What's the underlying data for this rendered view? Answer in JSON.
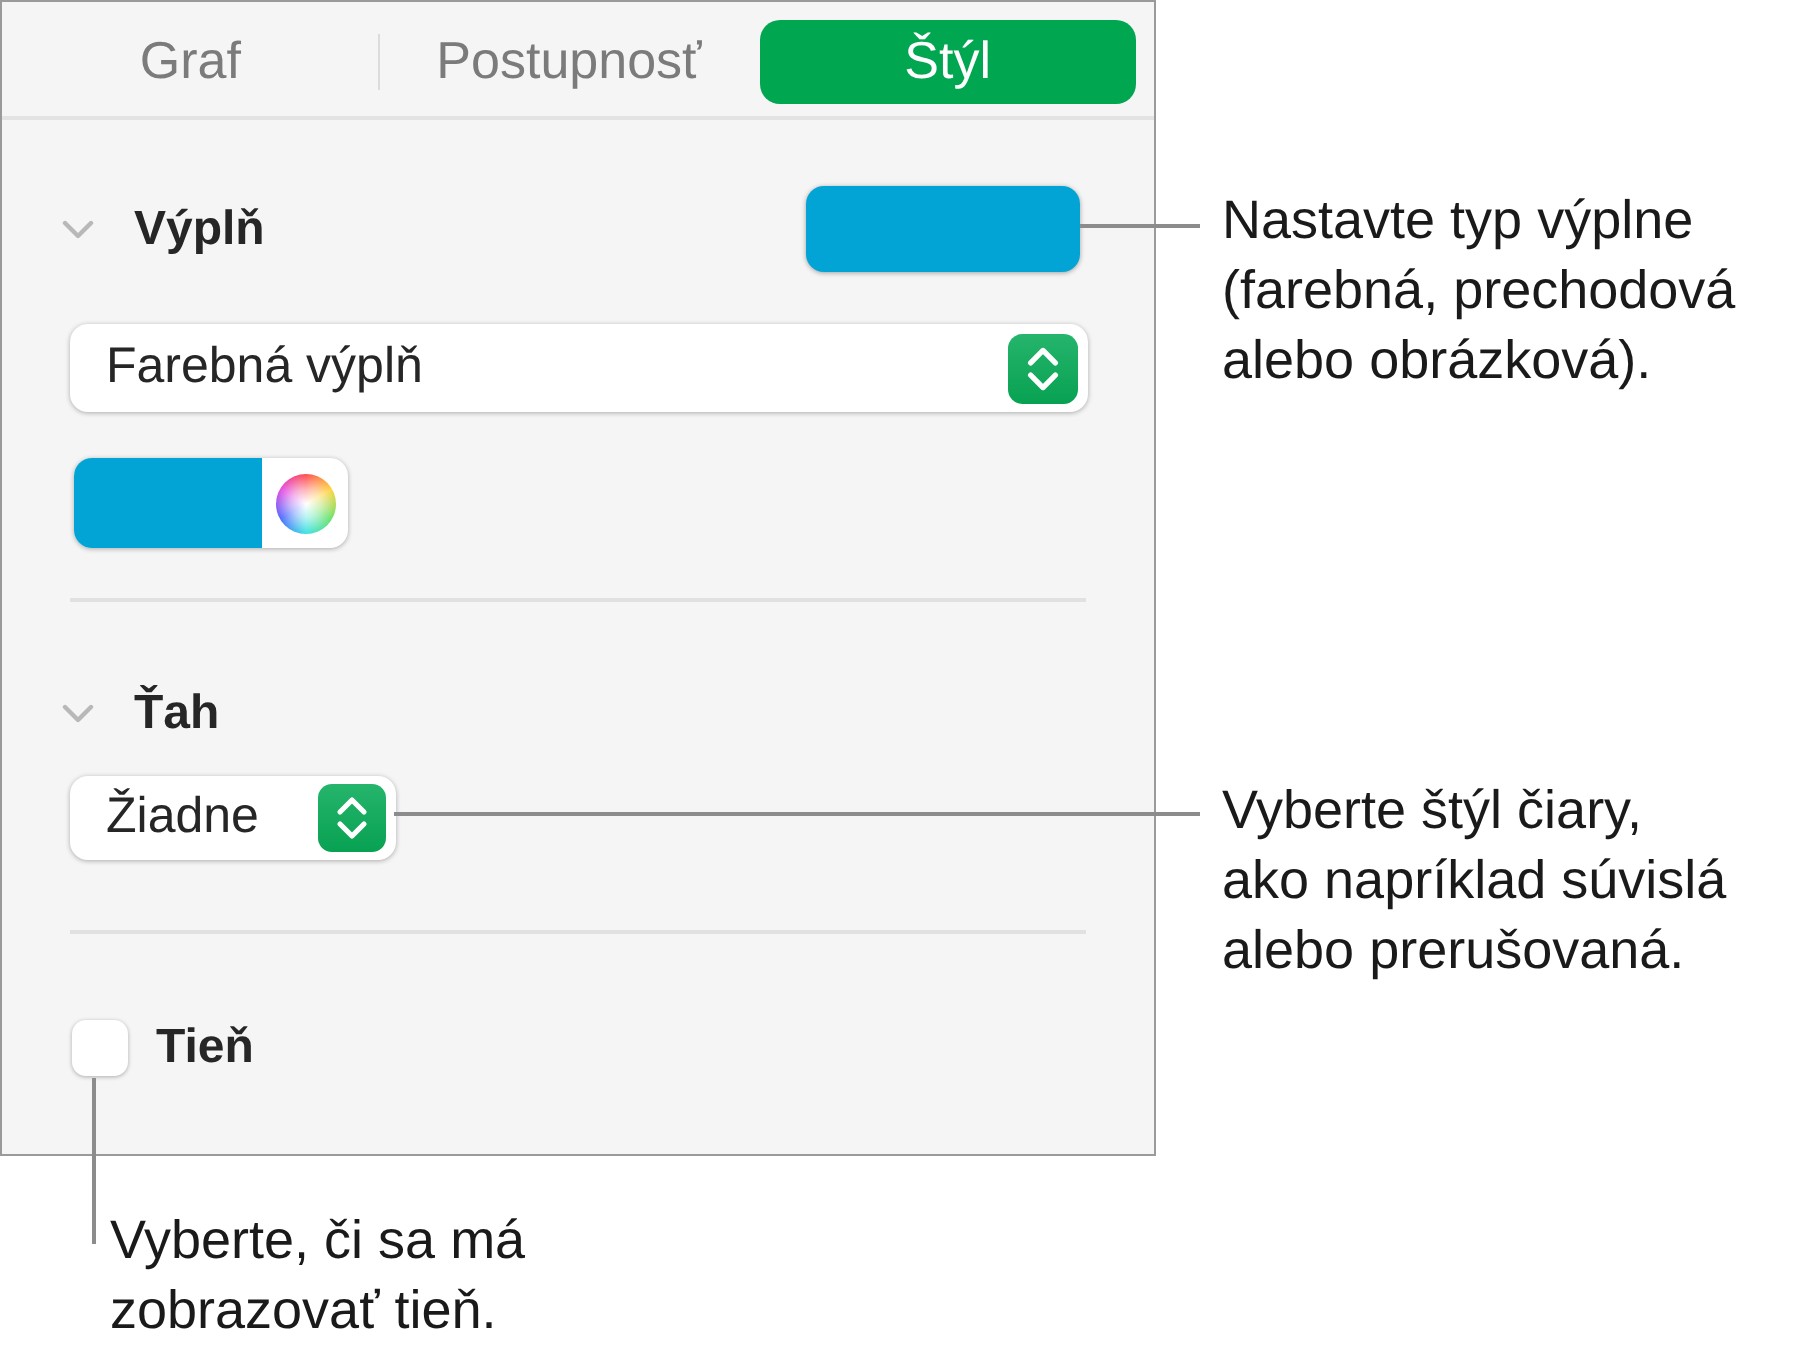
{
  "tabs": [
    {
      "label": "Graf",
      "selected": false
    },
    {
      "label": "Postupnosť",
      "selected": false
    },
    {
      "label": "Štýl",
      "selected": true
    }
  ],
  "sections": [
    {
      "kind": "fill",
      "title": "Výplň",
      "expanded": true,
      "well": {
        "color": "#02a4d6"
      },
      "popup": {
        "value": "Farebná výplň"
      },
      "swatch": {
        "color": "#02a4d6"
      }
    },
    {
      "kind": "stroke",
      "title": "Ťah",
      "expanded": true,
      "popup": {
        "value": "Žiadne"
      }
    },
    {
      "kind": "toggle",
      "title": "Tieň",
      "checked": false
    }
  ],
  "callouts": [
    {
      "lines": [
        "Nastavte typ výplne",
        "(farebná, prechodová",
        "alebo obrázková)."
      ]
    },
    {
      "lines": [
        "Vyberte štýl čiary,",
        "ako napríklad súvislá",
        "alebo prerušovaná."
      ]
    },
    {
      "lines": [
        "Vyberte, či sa má",
        "zobrazovať tieň."
      ]
    }
  ]
}
